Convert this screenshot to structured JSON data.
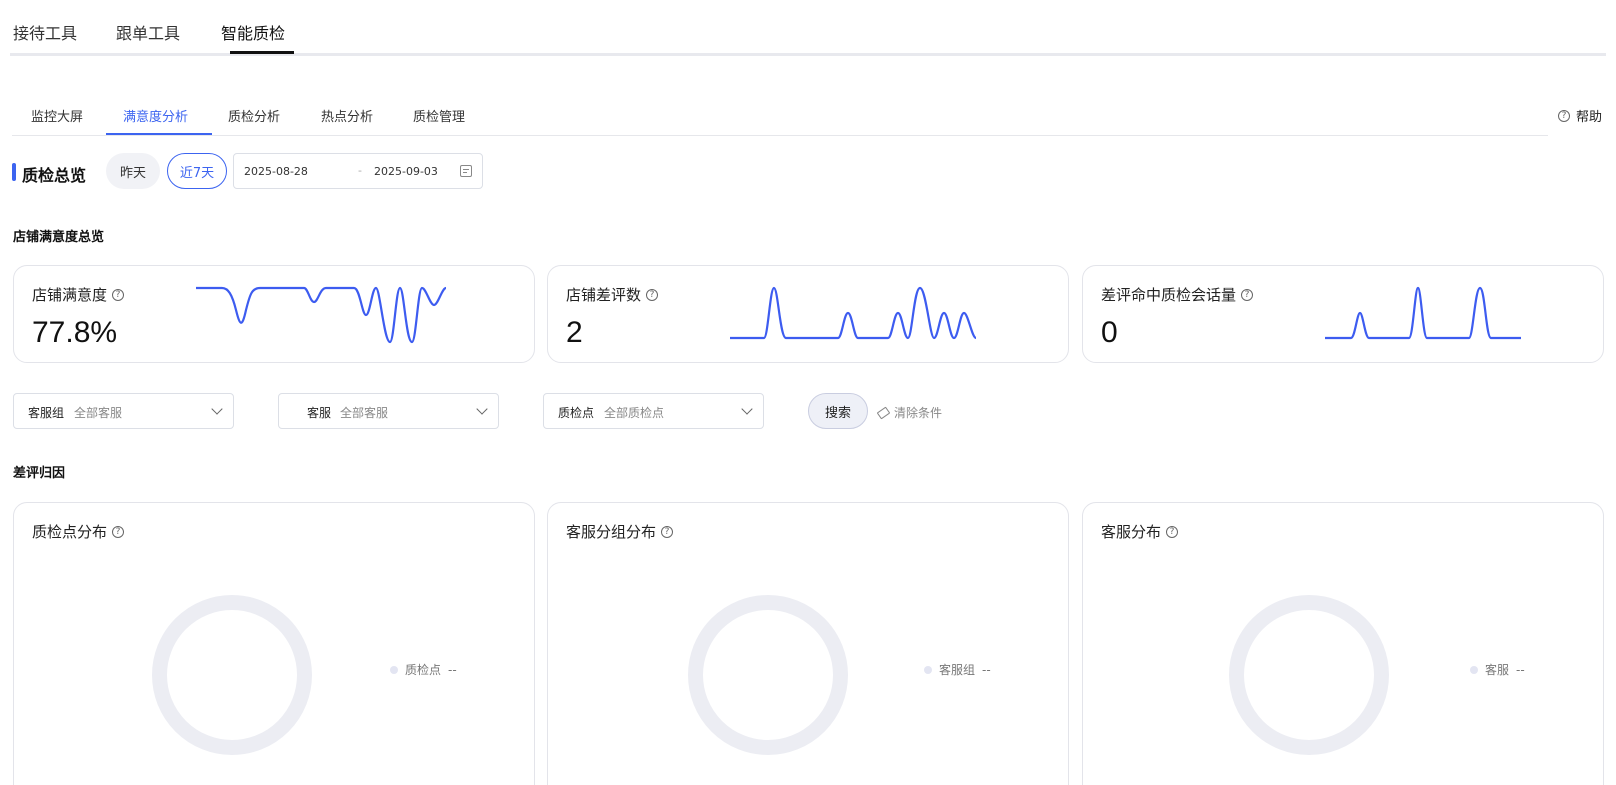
{
  "top_tabs": [
    "接待工具",
    "跟单工具",
    "智能质检"
  ],
  "sub_tabs": [
    "监控大屏",
    "满意度分析",
    "质检分析",
    "热点分析",
    "质检管理"
  ],
  "help_label": "帮助",
  "overview": {
    "title": "质检总览",
    "quick_ranges": [
      "昨天",
      "近7天"
    ],
    "date_start": "2025-08-28",
    "date_sep": "-",
    "date_end": "2025-09-03"
  },
  "store_section_title": "店铺满意度总览",
  "metrics": [
    {
      "label": "店铺满意度",
      "value": "77.8%"
    },
    {
      "label": "店铺差评数",
      "value": "2"
    },
    {
      "label": "差评命中质检会话量",
      "value": "0"
    }
  ],
  "filters": [
    {
      "label": "客服组",
      "value": "全部客服"
    },
    {
      "label": "客服",
      "value": "全部客服"
    },
    {
      "label": "质检点",
      "value": "全部质检点"
    }
  ],
  "search_label": "搜索",
  "clear_label": "清除条件",
  "attribution_title": "差评归因",
  "distributions": [
    {
      "title": "质检点分布",
      "legend": "质检点",
      "legend_value": "--"
    },
    {
      "title": "客服分组分布",
      "legend": "客服组",
      "legend_value": "--"
    },
    {
      "title": "客服分布",
      "legend": "客服",
      "legend_value": "--"
    }
  ],
  "accent_color": "#3c64f0",
  "spark_color": "#3d5cf0"
}
